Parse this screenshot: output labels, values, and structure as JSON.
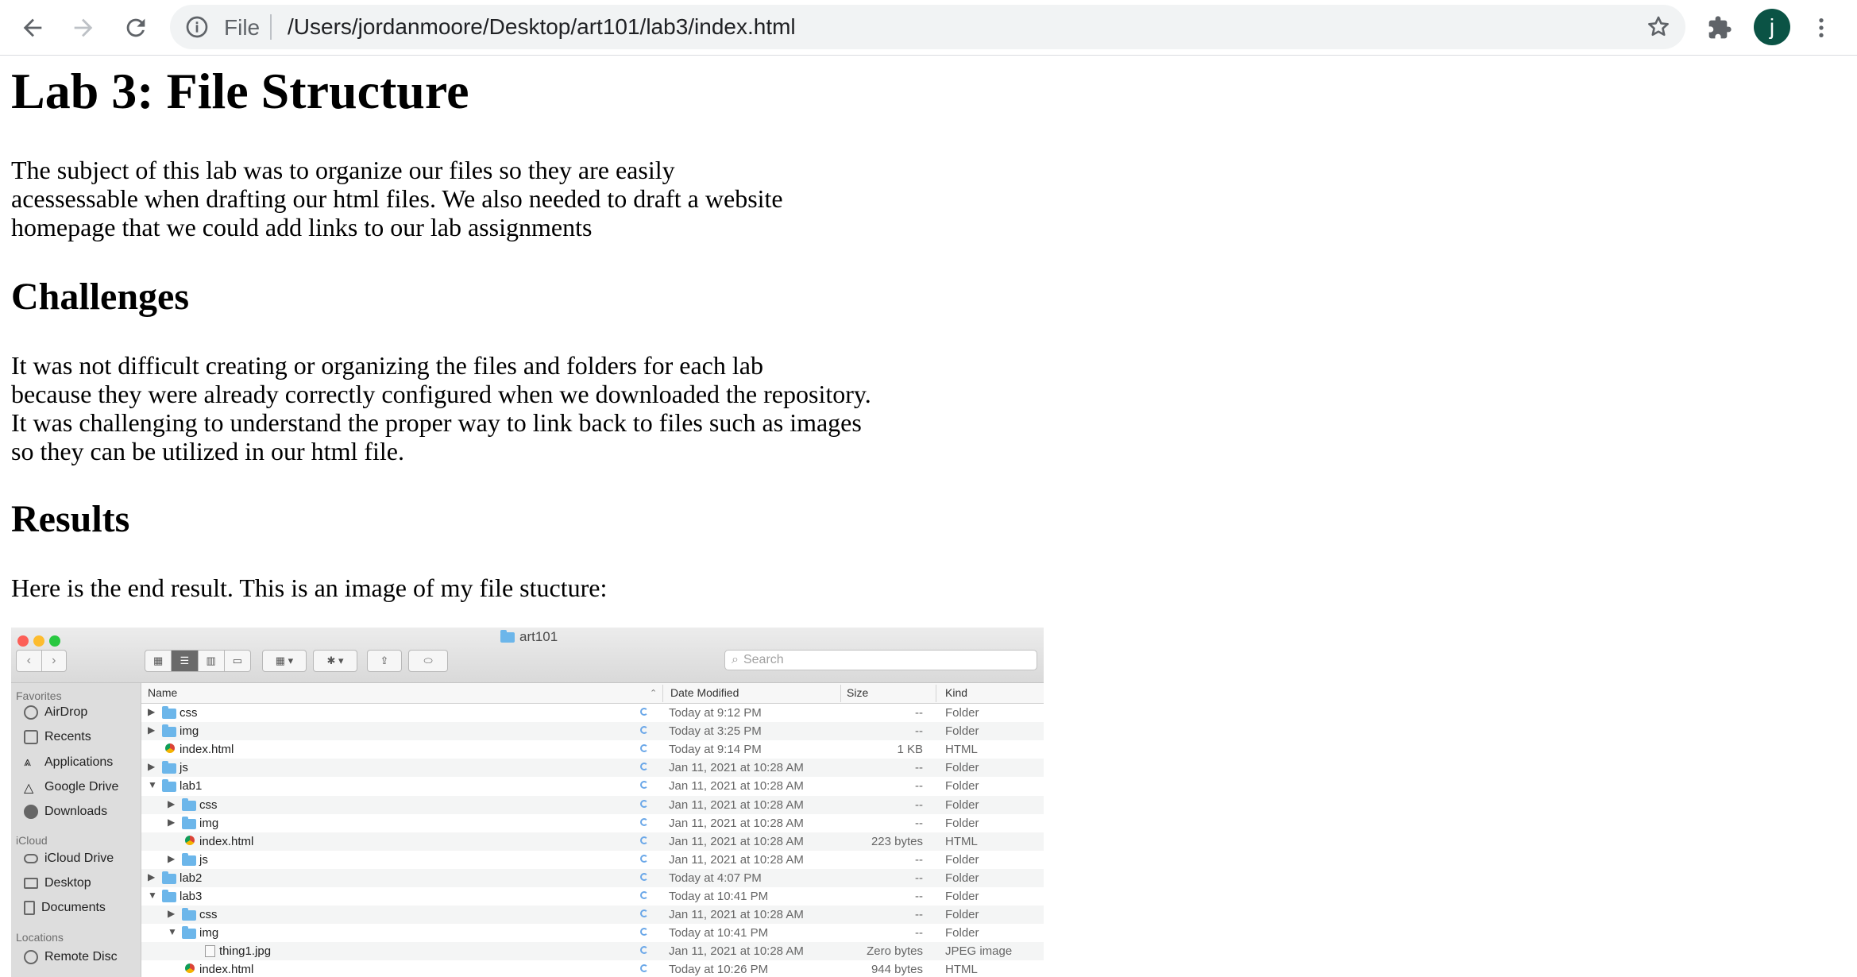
{
  "browser": {
    "omnibox_scheme": "File",
    "url": "/Users/jordanmoore/Desktop/art101/lab3/index.html",
    "avatar_letter": "j",
    "icons": [
      "back-arrow-icon",
      "forward-arrow-icon",
      "reload-icon",
      "info-icon",
      "star-icon",
      "puzzle-icon",
      "kebab-menu-icon"
    ]
  },
  "page": {
    "title": "Lab 3: File Structure",
    "intro_lines": [
      "The subject of this lab was to organize our files so they are easily",
      "acessessable when drafting our html files. We also needed to draft a website",
      "homepage that we could add links to our lab assignments"
    ],
    "challenges_heading": "Challenges",
    "challenges_lines": [
      "It was not difficult creating or organizing the files and folders for each lab",
      "because they were already correctly configured when we downloaded the repository.",
      "It was challenging to understand the proper way to link back to files such as images",
      "so they can be utilized in our html file."
    ],
    "results_heading": "Results",
    "results_text": "Here is the end result. This is an image of my file stucture:"
  },
  "finder": {
    "window_title": "art101",
    "search_placeholder": "Search",
    "sidebar": {
      "favorites_label": "Favorites",
      "favorites": [
        "AirDrop",
        "Recents",
        "Applications",
        "Google Drive",
        "Downloads"
      ],
      "icloud_label": "iCloud",
      "icloud": [
        "iCloud Drive",
        "Desktop",
        "Documents"
      ],
      "locations_label": "Locations",
      "locations": [
        "Remote Disc"
      ]
    },
    "columns": {
      "name": "Name",
      "date": "Date Modified",
      "size": "Size",
      "kind": "Kind"
    },
    "rows": [
      {
        "name": "css",
        "date": "Today at 9:12 PM",
        "size": "--",
        "kind": "Folder",
        "level": 0,
        "type": "folder",
        "expanded": false
      },
      {
        "name": "img",
        "date": "Today at 3:25 PM",
        "size": "--",
        "kind": "Folder",
        "level": 0,
        "type": "folder",
        "expanded": false
      },
      {
        "name": "index.html",
        "date": "Today at 9:14 PM",
        "size": "1 KB",
        "kind": "HTML",
        "level": 0,
        "type": "html",
        "expanded": false
      },
      {
        "name": "js",
        "date": "Jan 11, 2021 at 10:28 AM",
        "size": "--",
        "kind": "Folder",
        "level": 0,
        "type": "folder",
        "expanded": false
      },
      {
        "name": "lab1",
        "date": "Jan 11, 2021 at 10:28 AM",
        "size": "--",
        "kind": "Folder",
        "level": 0,
        "type": "folder",
        "expanded": true
      },
      {
        "name": "css",
        "date": "Jan 11, 2021 at 10:28 AM",
        "size": "--",
        "kind": "Folder",
        "level": 1,
        "type": "folder",
        "expanded": false
      },
      {
        "name": "img",
        "date": "Jan 11, 2021 at 10:28 AM",
        "size": "--",
        "kind": "Folder",
        "level": 1,
        "type": "folder",
        "expanded": false
      },
      {
        "name": "index.html",
        "date": "Jan 11, 2021 at 10:28 AM",
        "size": "223 bytes",
        "kind": "HTML",
        "level": 1,
        "type": "html",
        "expanded": false
      },
      {
        "name": "js",
        "date": "Jan 11, 2021 at 10:28 AM",
        "size": "--",
        "kind": "Folder",
        "level": 1,
        "type": "folder",
        "expanded": false
      },
      {
        "name": "lab2",
        "date": "Today at 4:07 PM",
        "size": "--",
        "kind": "Folder",
        "level": 0,
        "type": "folder",
        "expanded": false
      },
      {
        "name": "lab3",
        "date": "Today at 10:41 PM",
        "size": "--",
        "kind": "Folder",
        "level": 0,
        "type": "folder",
        "expanded": true
      },
      {
        "name": "css",
        "date": "Jan 11, 2021 at 10:28 AM",
        "size": "--",
        "kind": "Folder",
        "level": 1,
        "type": "folder",
        "expanded": false
      },
      {
        "name": "img",
        "date": "Today at 10:41 PM",
        "size": "--",
        "kind": "Folder",
        "level": 1,
        "type": "folder",
        "expanded": true
      },
      {
        "name": "thing1.jpg",
        "date": "Jan 11, 2021 at 10:28 AM",
        "size": "Zero bytes",
        "kind": "JPEG image",
        "level": 2,
        "type": "jpg",
        "expanded": false
      },
      {
        "name": "index.html",
        "date": "Today at 10:26 PM",
        "size": "944 bytes",
        "kind": "HTML",
        "level": 1,
        "type": "html",
        "expanded": false
      }
    ]
  }
}
